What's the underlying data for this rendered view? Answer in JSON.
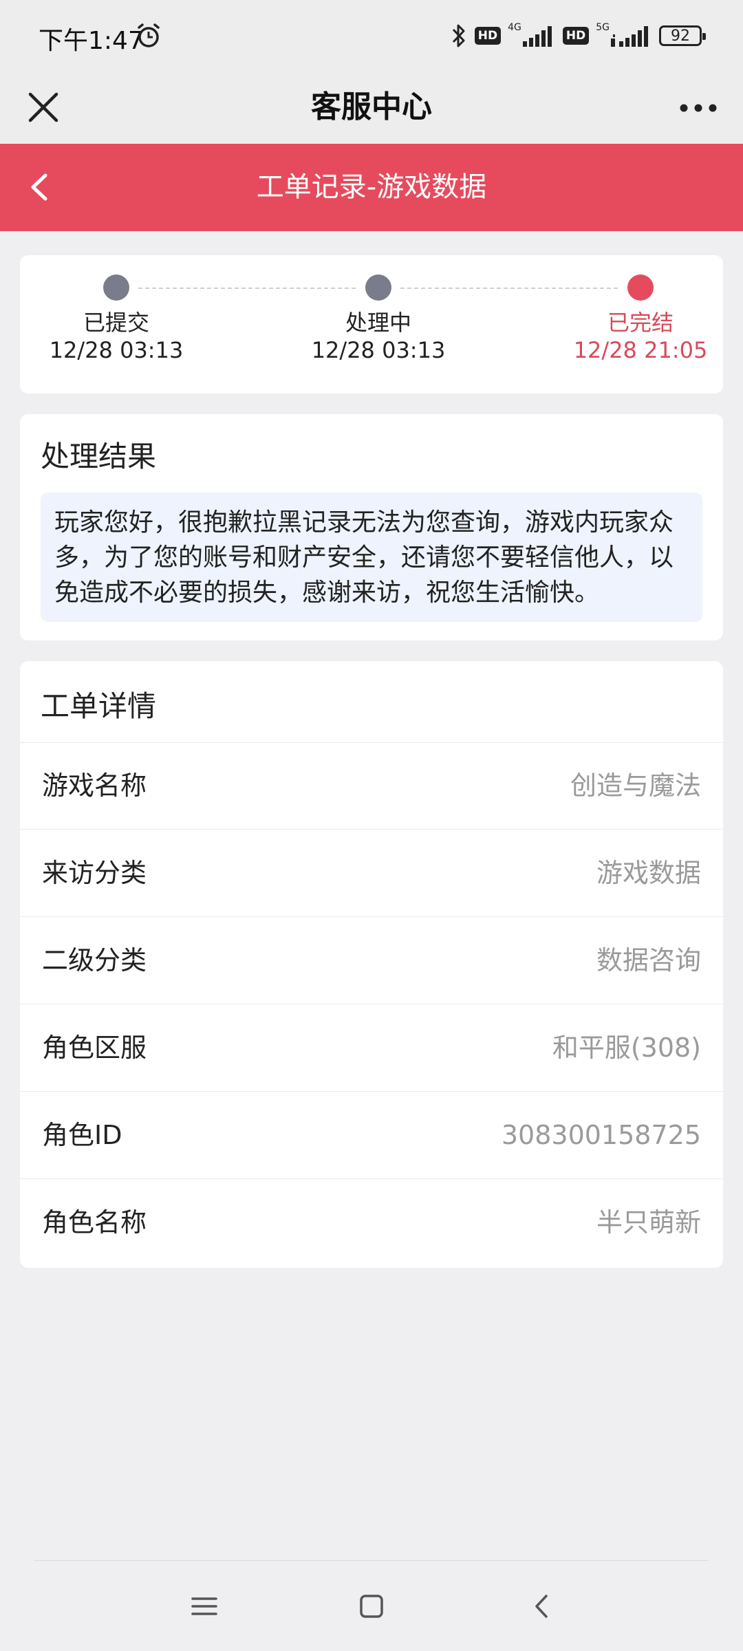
{
  "status_bar": {
    "time": "下午1:47",
    "hd1": "HD",
    "net1": "4G",
    "hd2": "HD",
    "net2": "5G",
    "battery": "92"
  },
  "nav": {
    "title": "客服中心"
  },
  "header": {
    "title": "工单记录-游戏数据"
  },
  "progress": {
    "steps": [
      {
        "label": "已提交",
        "time": "12/28 03:13"
      },
      {
        "label": "处理中",
        "time": "12/28 03:13"
      },
      {
        "label": "已完结",
        "time": "12/28 21:05"
      }
    ],
    "current_step": 3
  },
  "result": {
    "title": "处理结果",
    "text": "玩家您好，很抱歉拉黑记录无法为您查询，游戏内玩家众多，为了您的账号和财产安全，还请您不要轻信他人，以免造成不必要的损失，感谢来访，祝您生活愉快。"
  },
  "detail": {
    "title": "工单详情",
    "rows": [
      {
        "key": "游戏名称",
        "value": "创造与魔法"
      },
      {
        "key": "来访分类",
        "value": "游戏数据"
      },
      {
        "key": "二级分类",
        "value": "数据咨询"
      },
      {
        "key": "角色区服",
        "value": "和平服(308)"
      },
      {
        "key": "角色ID",
        "value": "308300158725"
      },
      {
        "key": "角色名称",
        "value": "半只萌新"
      }
    ]
  },
  "colors": {
    "accent": "#e64b5d",
    "step_inactive": "#7a7c8c",
    "result_bg": "#eef3fd"
  },
  "icons": [
    "alarm-icon",
    "bluetooth-icon",
    "signal-icon",
    "battery-icon",
    "close-icon",
    "more-icon",
    "back-icon",
    "menu-icon",
    "home-icon",
    "nav-back-icon"
  ]
}
